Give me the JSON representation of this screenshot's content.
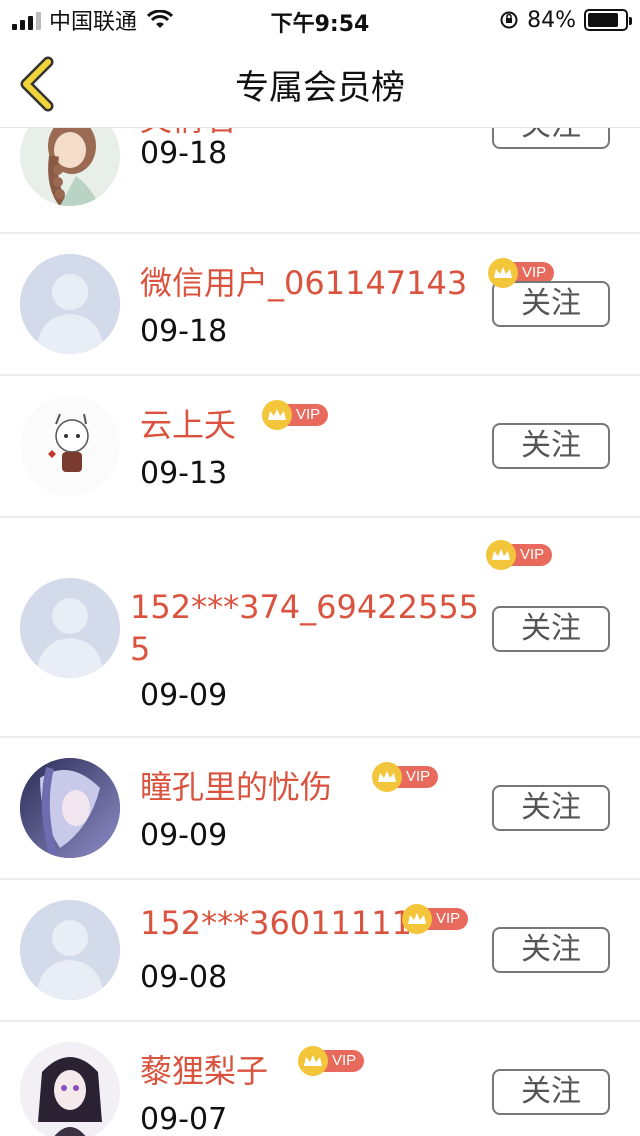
{
  "status_bar": {
    "carrier": "中国联通",
    "time": "下午9:54",
    "battery": "84%",
    "battery_level": 0.84
  },
  "nav": {
    "title": "专属会员榜",
    "back_icon": "chevron-left-icon",
    "accent_color": "#f0d43a"
  },
  "colors": {
    "name": "#d9533f",
    "vip_badge": "#e86a5c",
    "crown": "#f3c53a"
  },
  "vip_label": "VIP",
  "follow_label": "关注",
  "members": [
    {
      "name": "芙倩若",
      "date": "09-18",
      "avatar": "illustrated-girl-braid"
    },
    {
      "name": "微信用户_061147143",
      "date": "09-18",
      "avatar": "default-avatar"
    },
    {
      "name": "云上夭",
      "date": "09-13",
      "avatar": "cartoon-avatar"
    },
    {
      "name": "152***374_694225555",
      "date": "09-09",
      "avatar": "default-avatar"
    },
    {
      "name": "瞳孔里的忧伤",
      "date": "09-09",
      "avatar": "illustrated-girl-purple"
    },
    {
      "name": "152***36011111",
      "date": "09-08",
      "avatar": "default-avatar"
    },
    {
      "name": "藜狸梨子",
      "date": "09-07",
      "avatar": "illustrated-girl-dark-hair"
    }
  ]
}
